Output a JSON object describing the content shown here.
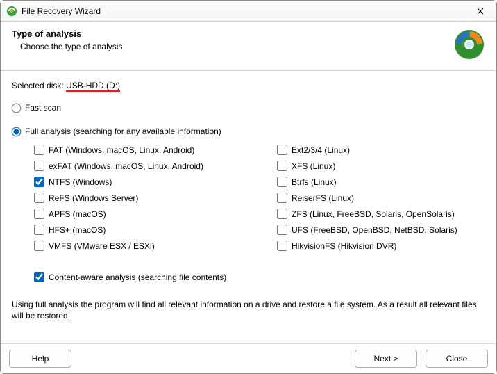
{
  "titlebar": {
    "title": "File Recovery Wizard",
    "close_aria": "Close"
  },
  "header": {
    "title": "Type of analysis",
    "subtitle": "Choose the type of analysis"
  },
  "selected_disk": {
    "label": "Selected disk: ",
    "value": "USB-HDD (D:)"
  },
  "scan": {
    "fast_label": "Fast scan",
    "full_label": "Full analysis (searching for any available information)",
    "selected": "full"
  },
  "filesystems_left": [
    {
      "label": "FAT (Windows, macOS, Linux, Android)",
      "checked": false
    },
    {
      "label": "exFAT (Windows, macOS, Linux, Android)",
      "checked": false
    },
    {
      "label": "NTFS (Windows)",
      "checked": true
    },
    {
      "label": "ReFS (Windows Server)",
      "checked": false
    },
    {
      "label": "APFS (macOS)",
      "checked": false
    },
    {
      "label": "HFS+ (macOS)",
      "checked": false
    },
    {
      "label": "VMFS (VMware ESX / ESXi)",
      "checked": false
    }
  ],
  "filesystems_right": [
    {
      "label": "Ext2/3/4 (Linux)",
      "checked": false
    },
    {
      "label": "XFS (Linux)",
      "checked": false
    },
    {
      "label": "Btrfs (Linux)",
      "checked": false
    },
    {
      "label": "ReiserFS (Linux)",
      "checked": false
    },
    {
      "label": "ZFS (Linux, FreeBSD, Solaris, OpenSolaris)",
      "checked": false
    },
    {
      "label": "UFS (FreeBSD, OpenBSD, NetBSD, Solaris)",
      "checked": false
    },
    {
      "label": "HikvisionFS (Hikvision DVR)",
      "checked": false
    }
  ],
  "content_aware": {
    "label": "Content-aware analysis (searching file contents)",
    "checked": true
  },
  "description": "Using full analysis the program will find all relevant information on a drive and restore a file system. As a result all relevant files will be restored.",
  "buttons": {
    "help": "Help",
    "next": "Next >",
    "close": "Close"
  }
}
